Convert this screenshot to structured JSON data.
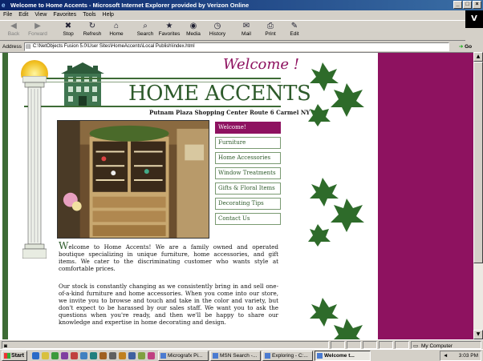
{
  "window": {
    "title": "Welcome to Home Accents - Microsoft Internet Explorer provided by Verizon Online",
    "controls": [
      "_",
      "□",
      "×"
    ]
  },
  "menu": [
    "File",
    "Edit",
    "View",
    "Favorites",
    "Tools",
    "Help"
  ],
  "brand_badge": "V",
  "toolbar": {
    "buttons": [
      {
        "label": "Back",
        "icon": "back-arrow-icon",
        "glyph": "◀",
        "disabled": true
      },
      {
        "label": "Forward",
        "icon": "forward-arrow-icon",
        "glyph": "▶",
        "disabled": true
      },
      {
        "label": "Stop",
        "icon": "stop-icon",
        "glyph": "✖",
        "disabled": false
      },
      {
        "label": "Refresh",
        "icon": "refresh-icon",
        "glyph": "↻",
        "disabled": false
      },
      {
        "label": "Home",
        "icon": "home-icon",
        "glyph": "⌂",
        "disabled": false
      },
      {
        "label": "Search",
        "icon": "search-icon",
        "glyph": "⌕",
        "disabled": false
      },
      {
        "label": "Favorites",
        "icon": "star-icon",
        "glyph": "★",
        "disabled": false
      },
      {
        "label": "Media",
        "icon": "media-icon",
        "glyph": "◉",
        "disabled": false
      },
      {
        "label": "History",
        "icon": "history-icon",
        "glyph": "◷",
        "disabled": false
      },
      {
        "label": "Mail",
        "icon": "mail-icon",
        "glyph": "✉",
        "disabled": false
      },
      {
        "label": "Print",
        "icon": "print-icon",
        "glyph": "⎙",
        "disabled": false
      },
      {
        "label": "Edit",
        "icon": "edit-icon",
        "glyph": "✎",
        "disabled": false
      }
    ]
  },
  "address": {
    "label": "Address",
    "value": "C:\\NetObjects Fusion 5.0\\User Sites\\HomeAccents\\Local Publish\\index.html",
    "go_label": "Go"
  },
  "site": {
    "welcome_heading": "Welcome !",
    "logo_text": "HOME ACCENTS",
    "store_address": "Putnam Plaza Shopping Center Route 6 Carmel NY",
    "nav": [
      {
        "label": "Welcome!",
        "active": true
      },
      {
        "label": "Furniture",
        "active": false
      },
      {
        "label": "Home Accessories",
        "active": false
      },
      {
        "label": "Window Treatments",
        "active": false
      },
      {
        "label": "Gifts & Floral Items",
        "active": false
      },
      {
        "label": "Decorating Tips",
        "active": false
      },
      {
        "label": "Contact Us",
        "active": false
      }
    ],
    "intro_dropcap": "W",
    "intro_rest": "elcome to Home Accents! We are a family owned and operated boutique specializing in unique furniture, home accessories, and gift items. We cater to the discriminating customer who wants style at comfortable prices.",
    "para2": "Our stock is constantly changing as we consistently bring in and sell one-of-a-kind furniture and home accessories. When you come into our store, we invite you to browse and touch and take in the color and variety, but don't expect to be harassed by our sales staff. We want you to ask the questions when you're ready, and then we'll be happy to share our knowledge and expertise in home decorating and design."
  },
  "status": {
    "zone": "My Computer"
  },
  "taskbar": {
    "start_label": "Start",
    "tasks": [
      {
        "label": "Micrografx Pi...",
        "active": false
      },
      {
        "label": "MSN Search -...",
        "active": false
      },
      {
        "label": "Exploring - C:...",
        "active": false
      },
      {
        "label": "Welcome t...",
        "active": true
      }
    ],
    "clock": "3:03 PM"
  },
  "colors": {
    "maroon": "#8e1260",
    "green": "#2d5a2a",
    "title_bar": "#0a246a"
  }
}
